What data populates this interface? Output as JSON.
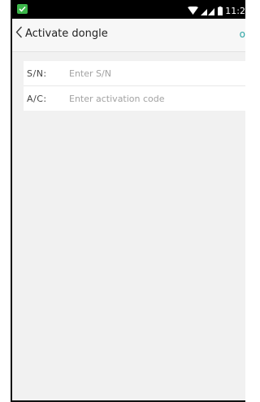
{
  "status_bar": {
    "time": "11:2",
    "icons": [
      "notification-check-icon",
      "wifi-icon",
      "signal-icon",
      "battery-icon"
    ]
  },
  "nav": {
    "title": "Activate dongle",
    "action_label": "o",
    "back_icon": "chevron-left-icon"
  },
  "form": {
    "sn": {
      "label": "S/N:",
      "placeholder": "Enter S/N",
      "value": ""
    },
    "ac": {
      "label": "A/C:",
      "placeholder": "Enter activation code",
      "value": ""
    }
  },
  "colors": {
    "accent": "#2aa4a4",
    "notification_green": "#3cb64a",
    "background": "#f1f1f1"
  }
}
